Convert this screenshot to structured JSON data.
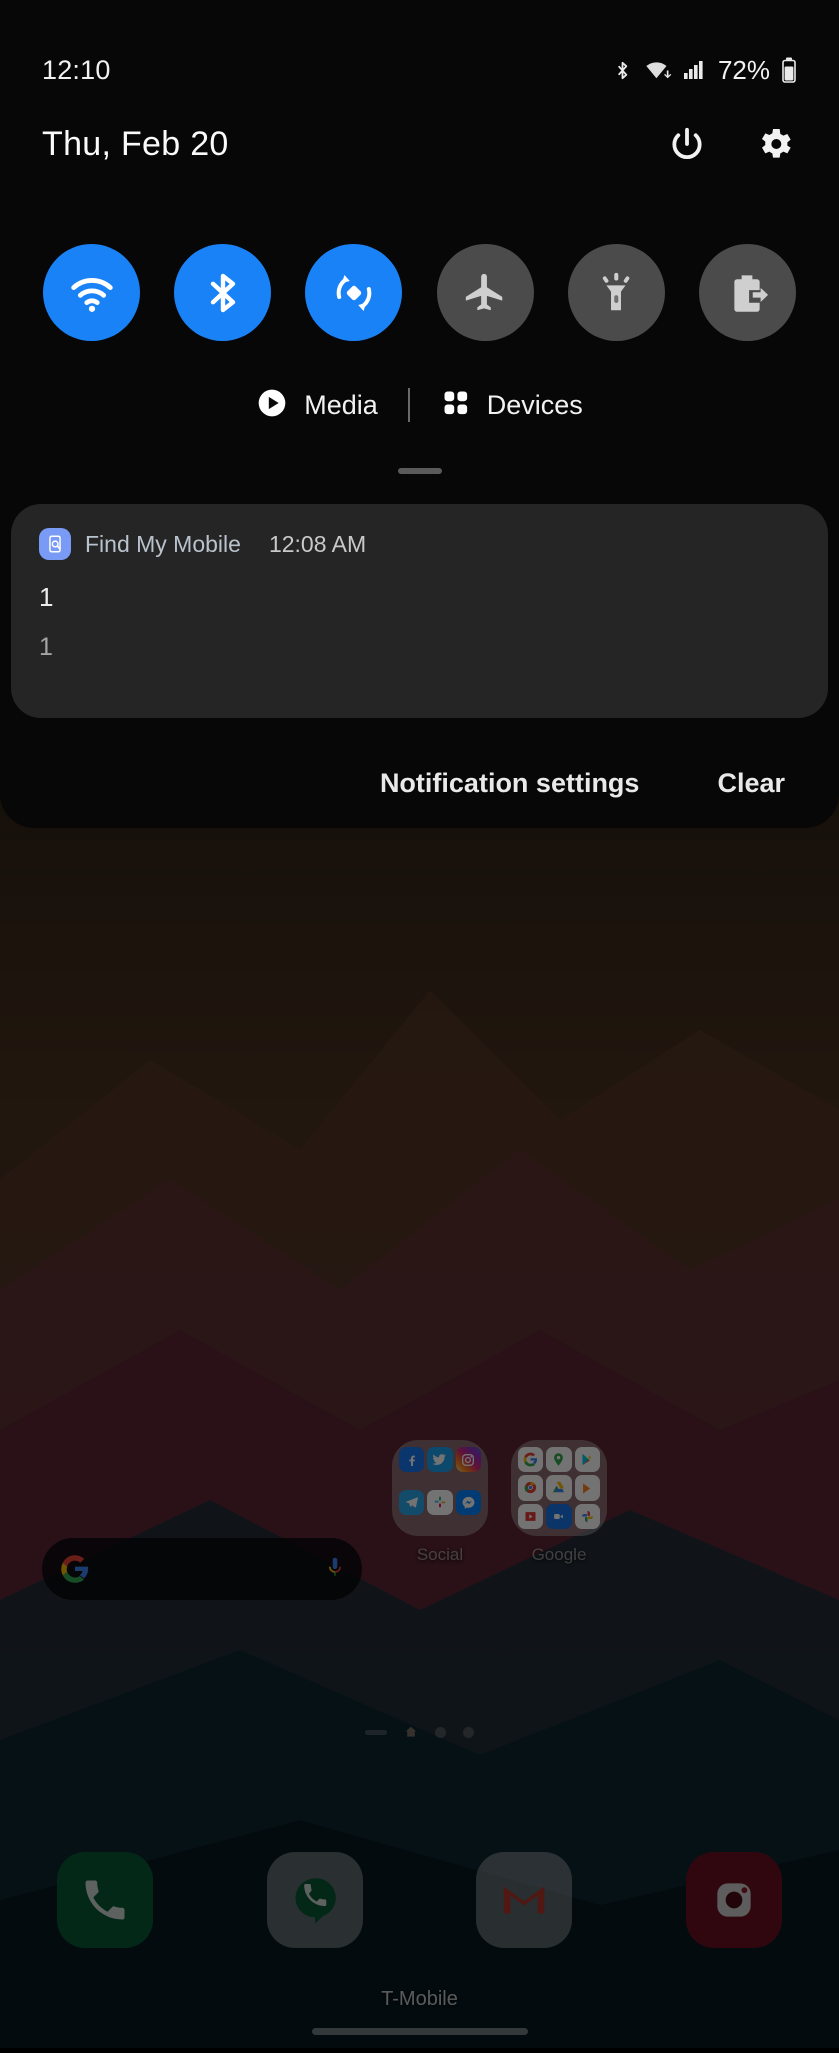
{
  "status_bar": {
    "time": "12:10",
    "battery_percent": "72%",
    "icons": [
      "bluetooth-icon",
      "wifi-icon",
      "signal-icon",
      "battery-icon"
    ]
  },
  "shade": {
    "date": "Thu, Feb 20",
    "power_button": "power-icon",
    "settings_button": "gear-icon",
    "toggles": [
      {
        "name": "wifi",
        "label": "Wi-Fi",
        "icon": "wifi-icon",
        "state": "on"
      },
      {
        "name": "bluetooth",
        "label": "Bluetooth",
        "icon": "bluetooth-icon",
        "state": "on"
      },
      {
        "name": "auto-rotate",
        "label": "Auto rotate",
        "icon": "auto-rotate-icon",
        "state": "on"
      },
      {
        "name": "airplane-mode",
        "label": "Airplane mode",
        "icon": "airplane-icon",
        "state": "off"
      },
      {
        "name": "flashlight",
        "label": "Flashlight",
        "icon": "flashlight-icon",
        "state": "off"
      },
      {
        "name": "power-share",
        "label": "Wireless PowerShare",
        "icon": "battery-share-icon",
        "state": "off"
      }
    ],
    "chips": [
      {
        "name": "media",
        "label": "Media",
        "icon": "play-circle-icon"
      },
      {
        "name": "devices",
        "label": "Devices",
        "icon": "grid-dots-icon"
      }
    ],
    "notification": {
      "app_name": "Find My Mobile",
      "app_icon": "find-my-mobile-icon",
      "time": "12:08 AM",
      "title": "1",
      "body": "1"
    },
    "footer": {
      "notification_settings": "Notification settings",
      "clear": "Clear"
    },
    "colors": {
      "toggle_on": "#1a82f7",
      "toggle_off": "#4b4b4b",
      "shade_bg": "#070707",
      "card_bg": "#252525"
    }
  },
  "home_screen": {
    "search_widget": {
      "name": "google-search-bar",
      "logo": "google-g-icon",
      "mic": "microphone-icon",
      "placeholder": ""
    },
    "folders": [
      {
        "name": "social-folder",
        "label": "Social",
        "apps": [
          "Facebook",
          "Twitter",
          "Instagram",
          "Telegram",
          "Slack",
          "Messenger"
        ]
      },
      {
        "name": "google-folder",
        "label": "Google",
        "apps": [
          "Google",
          "Maps",
          "Play Store",
          "Chrome",
          "Drive",
          "Play Music",
          "Play Movies",
          "Duo",
          "Photos"
        ]
      }
    ],
    "page_indicator": {
      "pages": 4,
      "current": 1
    },
    "dock": [
      {
        "name": "phone",
        "label": "Phone"
      },
      {
        "name": "voice",
        "label": "Voice"
      },
      {
        "name": "gmail",
        "label": "Gmail"
      },
      {
        "name": "instagram",
        "label": "Instagram"
      }
    ],
    "carrier": "T-Mobile",
    "gesture_bar": "home-gesture-bar"
  }
}
